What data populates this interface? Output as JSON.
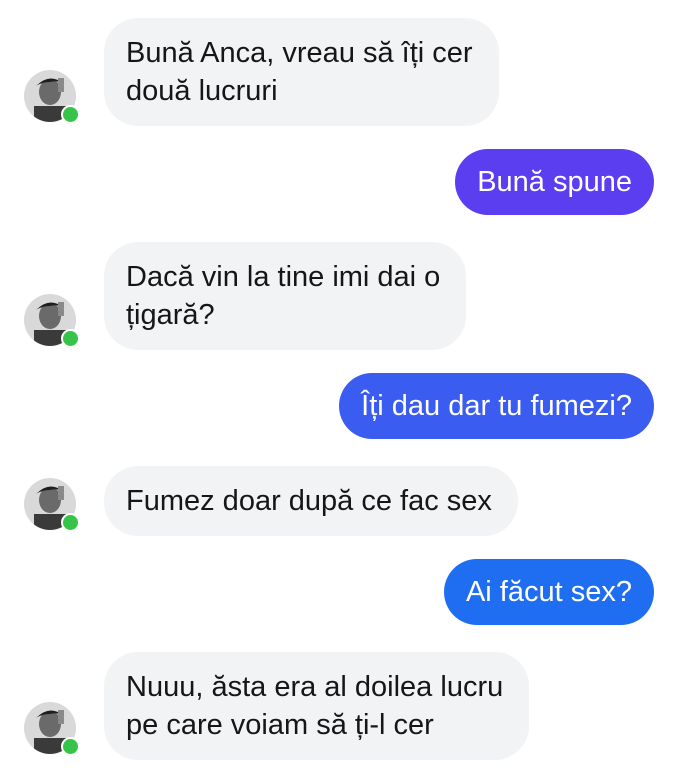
{
  "colors": {
    "incoming_bubble": "#f2f3f5",
    "outgoing_purple": "#5b3ef0",
    "outgoing_blue": "#1f6ef2",
    "online": "#37c24a"
  },
  "messages": [
    {
      "from": "contact",
      "lines": [
        "Bună Anca, vreau să îți cer",
        "două lucruri"
      ]
    },
    {
      "from": "me",
      "text": "Bună spune"
    },
    {
      "from": "contact",
      "lines": [
        "Dacă vin la tine imi dai o",
        "țigară?"
      ]
    },
    {
      "from": "me",
      "text": "Îți dau dar tu fumezi?"
    },
    {
      "from": "contact",
      "lines": [
        "Fumez doar după ce fac sex"
      ]
    },
    {
      "from": "me",
      "text": "Ai făcut sex?"
    },
    {
      "from": "contact",
      "lines": [
        "Nuuu, ăsta era al doilea lucru",
        "pe care voiam să ți-l cer"
      ]
    }
  ]
}
